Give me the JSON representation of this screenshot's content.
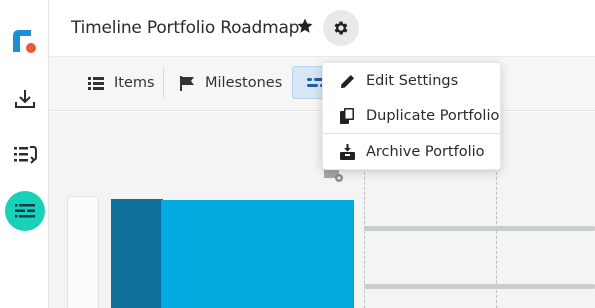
{
  "header": {
    "title": "Timeline Portfolio Roadmap"
  },
  "sidebar": {
    "items": [
      {
        "icon": "download-icon"
      },
      {
        "icon": "list-arrow-icon"
      },
      {
        "icon": "timeline-list-icon",
        "active": true
      }
    ]
  },
  "tabs": [
    {
      "label": "Items",
      "icon": "list-icon"
    },
    {
      "label": "Milestones",
      "icon": "flag-icon"
    },
    {
      "label": "",
      "icon": "timeline-icon",
      "active": true
    }
  ],
  "settings_menu": {
    "items": [
      {
        "label": "Edit Settings",
        "icon": "pencil-icon"
      },
      {
        "label": "Duplicate Portfolio",
        "icon": "copy-icon"
      },
      {
        "label": "Archive Portfolio",
        "icon": "archive-icon"
      }
    ]
  },
  "colors": {
    "accent": "#17d1b9",
    "bar_dark": "#0e6f9b",
    "bar_light": "#03aae0",
    "logo_blue": "#1f8fd4",
    "logo_red": "#f0543c"
  }
}
